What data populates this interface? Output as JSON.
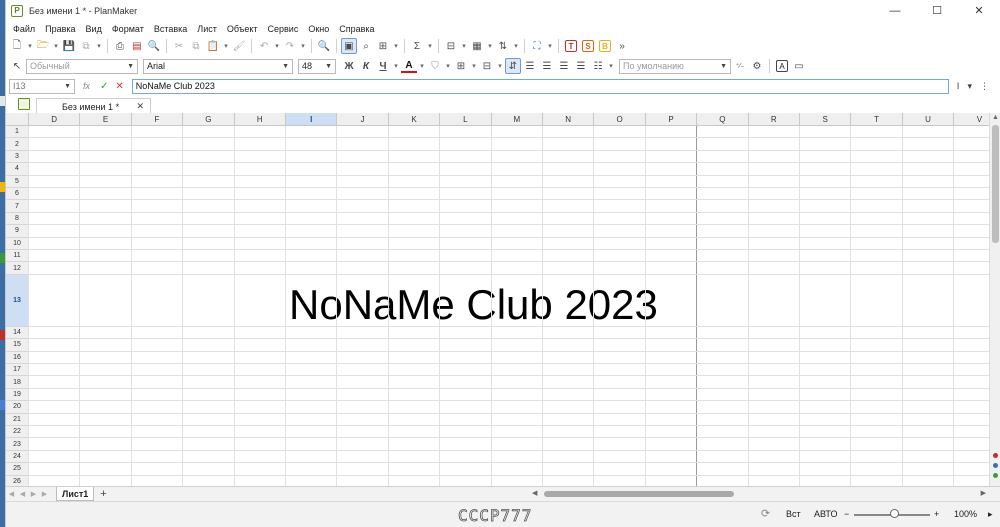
{
  "window": {
    "title": "Без имени 1 * - PlanMaker",
    "app_icon_letter": "P",
    "minimize": "—",
    "maximize": "☐",
    "close": "✕"
  },
  "menu": [
    "Файл",
    "Правка",
    "Вид",
    "Формат",
    "Вставка",
    "Лист",
    "Объект",
    "Сервис",
    "Окно",
    "Справка"
  ],
  "toolbar": {
    "more": "»",
    "letter_t": "T",
    "letter_s": "S",
    "letter_b": "B"
  },
  "format_bar": {
    "style_value": "Обычный",
    "font_value": "Arial",
    "size_value": "48",
    "bold": "Ж",
    "italic": "К",
    "underline": "Ч",
    "font_color": "A",
    "number_format_value": "По умолчанию",
    "frame_letter": "A"
  },
  "formula_bar": {
    "cell_ref": "I13",
    "fx": "fx",
    "ok": "✓",
    "cancel": "✕",
    "content": "NoNaMe Club 2023"
  },
  "doc_tab": {
    "label": "Без имени 1 *",
    "close": "✕"
  },
  "columns": [
    "D",
    "E",
    "F",
    "G",
    "H",
    "I",
    "J",
    "K",
    "L",
    "M",
    "N",
    "O",
    "P",
    "Q",
    "R",
    "S",
    "T",
    "U",
    "V"
  ],
  "selected_column": "I",
  "rows": [
    "1",
    "2",
    "3",
    "4",
    "5",
    "6",
    "7",
    "8",
    "9",
    "10",
    "11",
    "12",
    "13",
    "14",
    "15",
    "16",
    "17",
    "18",
    "19",
    "20",
    "21",
    "22",
    "23",
    "24",
    "25",
    "26"
  ],
  "selected_row": "13",
  "cell_text": "NoNaMe Club 2023",
  "sheet_tab": {
    "name": "Лист1",
    "add": "+"
  },
  "status": {
    "watermark": "CCCP777",
    "mode_ins": "Вст",
    "mode_auto": "АВТО",
    "zoom_minus": "−",
    "zoom_plus": "+",
    "zoom": "100%",
    "more": "▸"
  },
  "colors": {
    "selection_header": "#cfdff3",
    "accent": "#6f9bd1",
    "desktop": "#3a6ea5"
  }
}
